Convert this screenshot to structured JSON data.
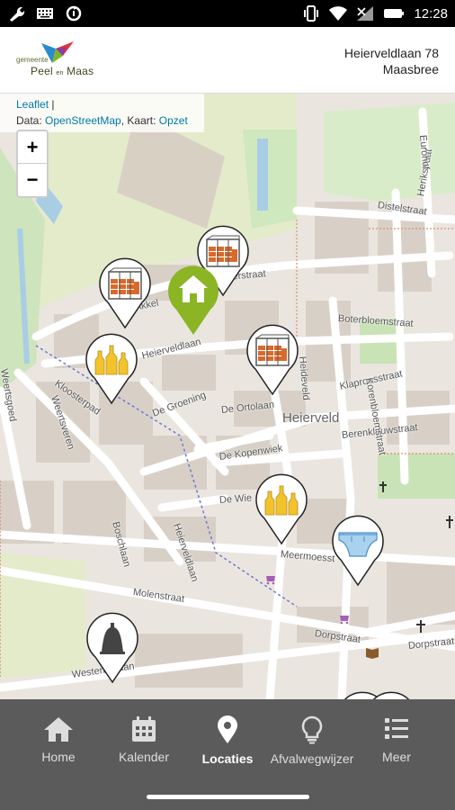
{
  "status_bar": {
    "time": "12:28"
  },
  "header": {
    "logo_small": "gemeente",
    "logo_peel": "Peel",
    "logo_en": "en",
    "logo_maas": "Maas",
    "address_line1": "Heierveldlaan 78",
    "address_line2": "Maasbree"
  },
  "map": {
    "attribution_leaflet": "Leaflet",
    "attribution_sep": " |",
    "attribution_data": "Data: ",
    "attribution_osm": "OpenStreetMap",
    "attribution_kaart": ", Kaart: ",
    "attribution_opzet": "Opzet",
    "zoom_in": "+",
    "zoom_out": "−",
    "area_label": "Heierveld",
    "streets": {
      "weertsgoed": "Weertsgoed",
      "kloosterpad": "Kloosterpad",
      "weertsveren": "Weertsveren",
      "akkerlaan": "Akkel",
      "heierveldlaan": "Heierveldlaan",
      "de_groening": "De Groening",
      "de_ortolaan": "De Ortolaan",
      "de_kopenwiek": "De Kopenwiek",
      "de_wielewaal": "De Wie",
      "boschlaan": "Boschlaan",
      "heierveldlaan2": "Heierveldlaan",
      "molenstraat": "Molenstraat",
      "westeringlaan": "Westeringlaan",
      "dorpstraat": "Dorpstraat",
      "dorpstraat2": "Dorpstraat",
      "klaproosstraat": "Klaproosstraat",
      "berenklauwstraat": "Berenklauwstraat",
      "boterbloemstraat": "Boterbloemstraat",
      "heidezicht": "Heideveld",
      "distelstraat": "Distelstraat",
      "herikstraat": "Herikstraat",
      "eurohof": "Eurohof",
      "korenbloemstraat": "Korenbloemstraat",
      "meermoesstraat": "Meermoesst",
      "heeraardstraat": "verstraat"
    },
    "markers": [
      {
        "id": "container-1",
        "icon": "cage-container-icon"
      },
      {
        "id": "container-2",
        "icon": "cage-container-icon"
      },
      {
        "id": "home",
        "icon": "home-icon"
      },
      {
        "id": "glass-1",
        "icon": "glass-bottles-icon"
      },
      {
        "id": "container-3",
        "icon": "cage-container-icon"
      },
      {
        "id": "glass-2",
        "icon": "glass-bottles-icon"
      },
      {
        "id": "diaper",
        "icon": "diaper-icon"
      },
      {
        "id": "bell",
        "icon": "bell-container-icon"
      }
    ],
    "colors": {
      "home_marker": "#8cb526",
      "marker_bg": "#ffffff",
      "brick": "#d96a2b",
      "glass": "#f2c42b"
    }
  },
  "nav": {
    "items": [
      {
        "label": "Home",
        "icon": "home-icon"
      },
      {
        "label": "Kalender",
        "icon": "calendar-icon"
      },
      {
        "label": "Locaties",
        "icon": "location-pin-icon",
        "active": true
      },
      {
        "label": "Afvalwegwijzer",
        "icon": "lightbulb-icon"
      },
      {
        "label": "Meer",
        "icon": "menu-list-icon"
      }
    ]
  }
}
